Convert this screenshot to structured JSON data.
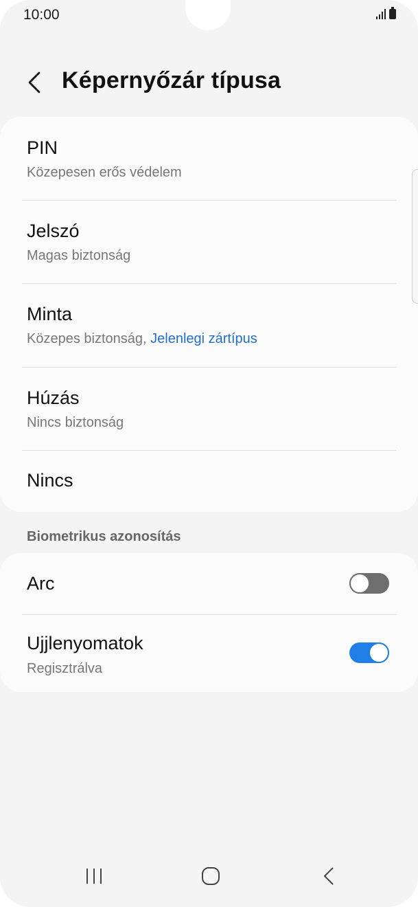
{
  "status_bar": {
    "time": "10:00",
    "signal_icon": "signal-bars-icon",
    "battery_icon": "battery-icon"
  },
  "header": {
    "back_icon": "chevron-left-icon",
    "title": "Képernyőzár típusa"
  },
  "lock_options": [
    {
      "title": "PIN",
      "subtitle": "Közepesen erős védelem"
    },
    {
      "title": "Jelszó",
      "subtitle": "Magas biztonság"
    },
    {
      "title": "Minta",
      "subtitle": "Közepes biztonság, ",
      "subtitle_accent": "Jelenlegi zártípus"
    },
    {
      "title": "Húzás",
      "subtitle": "Nincs biztonság"
    },
    {
      "title": "Nincs"
    }
  ],
  "biometrics": {
    "header": "Biometrikus azonosítás",
    "items": [
      {
        "title": "Arc",
        "toggle": "off"
      },
      {
        "title": "Ujjlenyomatok",
        "subtitle": "Regisztrálva",
        "toggle": "on"
      }
    ]
  },
  "nav_bar": {
    "recents_icon": "recent-apps-icon",
    "home_icon": "home-icon",
    "back_icon": "back-chevron-icon"
  },
  "colors": {
    "accent": "#1f6fd1",
    "toggle_on": "#1f7fe6",
    "toggle_off": "#6e6e6e",
    "background": "#f4f4f4",
    "card": "#fbfbfb"
  }
}
